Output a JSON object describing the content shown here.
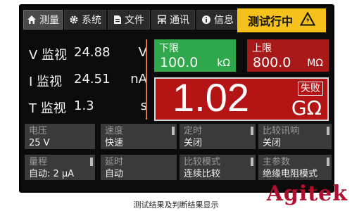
{
  "tabs": [
    {
      "label": "测量",
      "icon": "home-icon",
      "active": true
    },
    {
      "label": "系统",
      "icon": "gear-icon",
      "active": false
    },
    {
      "label": "文件",
      "icon": "document-icon",
      "active": false
    },
    {
      "label": "通讯",
      "icon": "network-icon",
      "active": false
    },
    {
      "label": "信息",
      "icon": "info-icon",
      "active": false
    }
  ],
  "status": {
    "label": "测试行中",
    "icon": "warning-icon",
    "color": "#f4c21a"
  },
  "readouts": [
    {
      "label": "V 监视",
      "value": "24.88",
      "unit": "V"
    },
    {
      "label": "I 监视",
      "value": "24.51",
      "unit": "nA"
    },
    {
      "label": "T 监视",
      "value": "1.3",
      "unit": "s"
    }
  ],
  "lower_limit": {
    "title": "下限",
    "value": "100.0",
    "unit": "kΩ",
    "color": "#2ea84a"
  },
  "upper_limit": {
    "title": "上限",
    "value": "800.0",
    "unit": "MΩ",
    "color": "#a81a1a"
  },
  "result": {
    "value": "1.02",
    "unit": "GΩ",
    "tag": "失败",
    "color": "#b41414"
  },
  "params": [
    {
      "title": "电压",
      "value": "25 V",
      "scroll": false
    },
    {
      "title": "速度",
      "value": "快速",
      "scroll": true
    },
    {
      "title": "定时",
      "value": "关闭",
      "scroll": true
    },
    {
      "title": "比较讯响",
      "value": "关闭",
      "scroll": true
    },
    {
      "title": "量程",
      "value": "自动: 2 μA",
      "scroll": true
    },
    {
      "title": "延时",
      "value": "自动",
      "scroll": false
    },
    {
      "title": "比较模式",
      "value": "连续比较",
      "scroll": true
    },
    {
      "title": "主参数",
      "value": "绝缘电阻模式",
      "scroll": true
    }
  ],
  "caption": "测试结果及判断结果显示",
  "logo": "Agitek"
}
